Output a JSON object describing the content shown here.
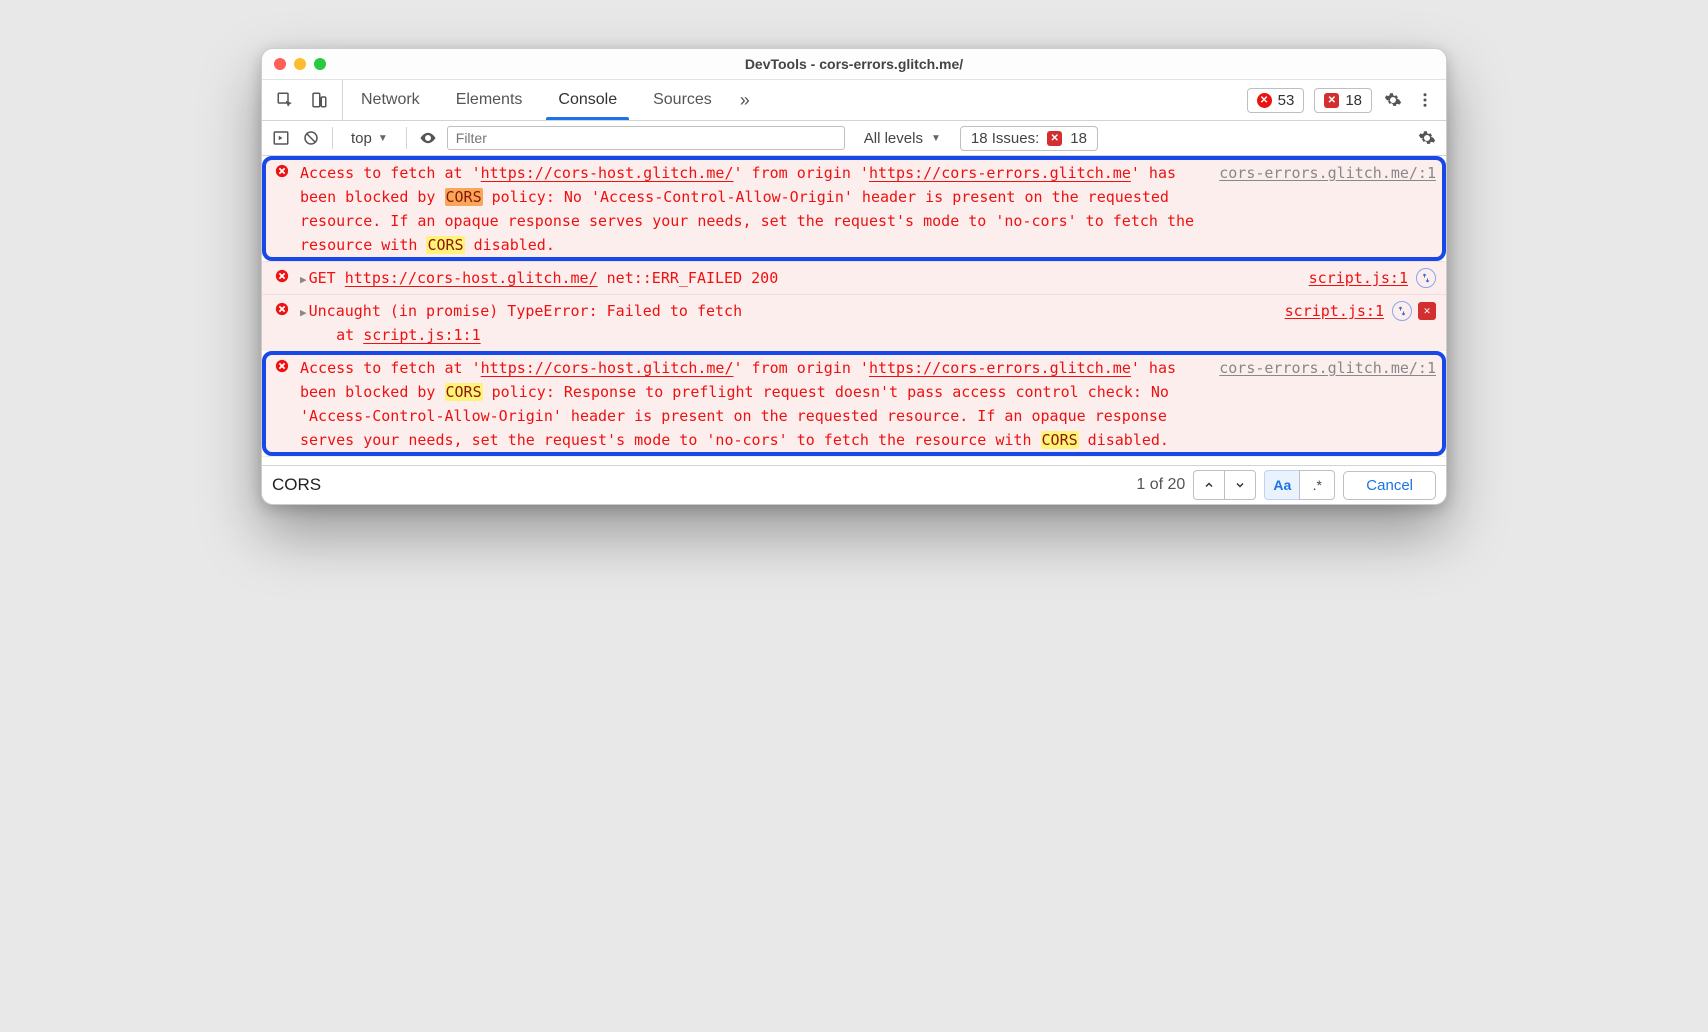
{
  "window": {
    "title": "DevTools - cors-errors.glitch.me/"
  },
  "tabs": {
    "items": [
      "Network",
      "Elements",
      "Console",
      "Sources"
    ],
    "active_index": 2
  },
  "badges": {
    "errors": "53",
    "issues": "18"
  },
  "console_toolbar": {
    "context": "top",
    "filter_placeholder": "Filter",
    "levels_label": "All levels",
    "issues_label": "18 Issues:",
    "issues_count": "18"
  },
  "messages": [
    {
      "framed": true,
      "type": "error",
      "source": "cors-errors.glitch.me/:1",
      "text_parts": [
        {
          "t": "Access to fetch at '"
        },
        {
          "t": "https://cors-host.glitch.me/",
          "link": true
        },
        {
          "t": "' from origin '"
        },
        {
          "t": "https://cors-errors.glitch.me",
          "link": true
        },
        {
          "t": "' has been blocked by "
        },
        {
          "t": "CORS",
          "hl": "strong"
        },
        {
          "t": " policy: No 'Access-Control-Allow-Origin' header is present on the requested resource. If an opaque response serves your needs, set the request's mode to 'no-cors' to fetch the resource with "
        },
        {
          "t": "CORS",
          "hl": "soft"
        },
        {
          "t": " disabled."
        }
      ]
    },
    {
      "framed": false,
      "type": "error",
      "expandable": true,
      "source": "script.js:1",
      "side_icons": [
        "portal"
      ],
      "text_parts": [
        {
          "t": "GET "
        },
        {
          "t": "https://cors-host.glitch.me/",
          "link": true
        },
        {
          "t": " net::ERR_FAILED 200"
        }
      ]
    },
    {
      "framed": false,
      "type": "error",
      "expandable": true,
      "source": "script.js:1",
      "side_icons": [
        "portal",
        "cross"
      ],
      "text_parts": [
        {
          "t": "Uncaught (in promise) TypeError: Failed to fetch"
        }
      ],
      "subline_parts": [
        {
          "t": "    at "
        },
        {
          "t": "script.js:1:1",
          "link": true
        }
      ]
    },
    {
      "framed": true,
      "type": "error",
      "source": "cors-errors.glitch.me/:1",
      "text_parts": [
        {
          "t": "Access to fetch at '"
        },
        {
          "t": "https://cors-host.glitch.me/",
          "link": true
        },
        {
          "t": "' from origin '"
        },
        {
          "t": "https://cors-errors.glitch.me",
          "link": true
        },
        {
          "t": "' has been blocked by "
        },
        {
          "t": "CORS",
          "hl": "soft"
        },
        {
          "t": " policy: Response to preflight request doesn't pass access control check: No 'Access-Control-Allow-Origin' header is present on the requested resource. If an opaque response serves your needs, set the request's mode to 'no-cors' to fetch the resource with "
        },
        {
          "t": "CORS",
          "hl": "soft"
        },
        {
          "t": " disabled."
        }
      ]
    }
  ],
  "findbar": {
    "query": "CORS",
    "count_text": "1 of 20",
    "match_case_active": true,
    "cancel_label": "Cancel"
  }
}
